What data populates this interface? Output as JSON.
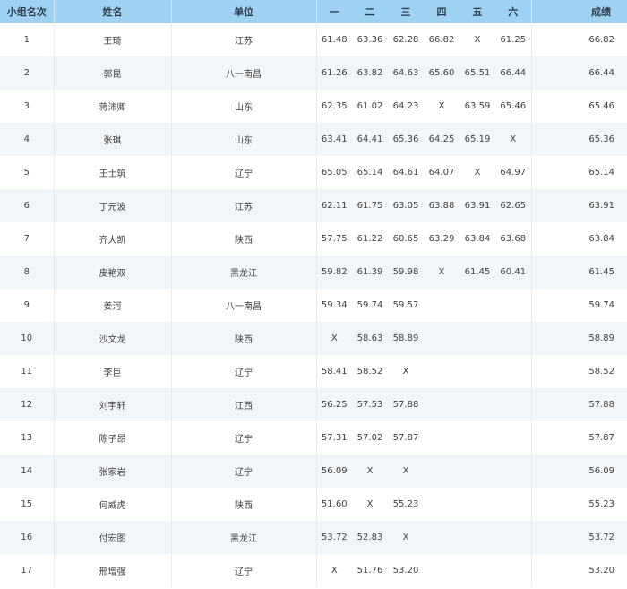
{
  "headers": {
    "rank": "小组名次",
    "name": "姓名",
    "unit": "单位",
    "a1": "一",
    "a2": "二",
    "a3": "三",
    "a4": "四",
    "a5": "五",
    "a6": "六",
    "result": "成绩"
  },
  "rows": [
    {
      "rank": "1",
      "name": "王琦",
      "unit": "江苏",
      "a": [
        "61.48",
        "63.36",
        "62.28",
        "66.82",
        "X",
        "61.25"
      ],
      "result": "66.82"
    },
    {
      "rank": "2",
      "name": "郭昆",
      "unit": "八一南昌",
      "a": [
        "61.26",
        "63.82",
        "64.63",
        "65.60",
        "65.51",
        "66.44"
      ],
      "result": "66.44"
    },
    {
      "rank": "3",
      "name": "蒋沛卿",
      "unit": "山东",
      "a": [
        "62.35",
        "61.02",
        "64.23",
        "X",
        "63.59",
        "65.46"
      ],
      "result": "65.46"
    },
    {
      "rank": "4",
      "name": "张琪",
      "unit": "山东",
      "a": [
        "63.41",
        "64.41",
        "65.36",
        "64.25",
        "65.19",
        "X"
      ],
      "result": "65.36"
    },
    {
      "rank": "5",
      "name": "王士筑",
      "unit": "辽宁",
      "a": [
        "65.05",
        "65.14",
        "64.61",
        "64.07",
        "X",
        "64.97"
      ],
      "result": "65.14"
    },
    {
      "rank": "6",
      "name": "丁元波",
      "unit": "江苏",
      "a": [
        "62.11",
        "61.75",
        "63.05",
        "63.88",
        "63.91",
        "62.65"
      ],
      "result": "63.91"
    },
    {
      "rank": "7",
      "name": "齐大凯",
      "unit": "陕西",
      "a": [
        "57.75",
        "61.22",
        "60.65",
        "63.29",
        "63.84",
        "63.68"
      ],
      "result": "63.84"
    },
    {
      "rank": "8",
      "name": "皮艳双",
      "unit": "黑龙江",
      "a": [
        "59.82",
        "61.39",
        "59.98",
        "X",
        "61.45",
        "60.41"
      ],
      "result": "61.45"
    },
    {
      "rank": "9",
      "name": "姜河",
      "unit": "八一南昌",
      "a": [
        "59.34",
        "59.74",
        "59.57",
        "",
        "",
        ""
      ],
      "result": "59.74"
    },
    {
      "rank": "10",
      "name": "沙文龙",
      "unit": "陕西",
      "a": [
        "X",
        "58.63",
        "58.89",
        "",
        "",
        ""
      ],
      "result": "58.89"
    },
    {
      "rank": "11",
      "name": "李巨",
      "unit": "辽宁",
      "a": [
        "58.41",
        "58.52",
        "X",
        "",
        "",
        ""
      ],
      "result": "58.52"
    },
    {
      "rank": "12",
      "name": "刘宇轩",
      "unit": "江西",
      "a": [
        "56.25",
        "57.53",
        "57.88",
        "",
        "",
        ""
      ],
      "result": "57.88"
    },
    {
      "rank": "13",
      "name": "陈子昂",
      "unit": "辽宁",
      "a": [
        "57.31",
        "57.02",
        "57.87",
        "",
        "",
        ""
      ],
      "result": "57.87"
    },
    {
      "rank": "14",
      "name": "张家岩",
      "unit": "辽宁",
      "a": [
        "56.09",
        "X",
        "X",
        "",
        "",
        ""
      ],
      "result": "56.09"
    },
    {
      "rank": "15",
      "name": "何威虎",
      "unit": "陕西",
      "a": [
        "51.60",
        "X",
        "55.23",
        "",
        "",
        ""
      ],
      "result": "55.23"
    },
    {
      "rank": "16",
      "name": "付宏图",
      "unit": "黑龙江",
      "a": [
        "53.72",
        "52.83",
        "X",
        "",
        "",
        ""
      ],
      "result": "53.72"
    },
    {
      "rank": "17",
      "name": "邢增强",
      "unit": "辽宁",
      "a": [
        "X",
        "51.76",
        "53.20",
        "",
        "",
        ""
      ],
      "result": "53.20"
    }
  ]
}
